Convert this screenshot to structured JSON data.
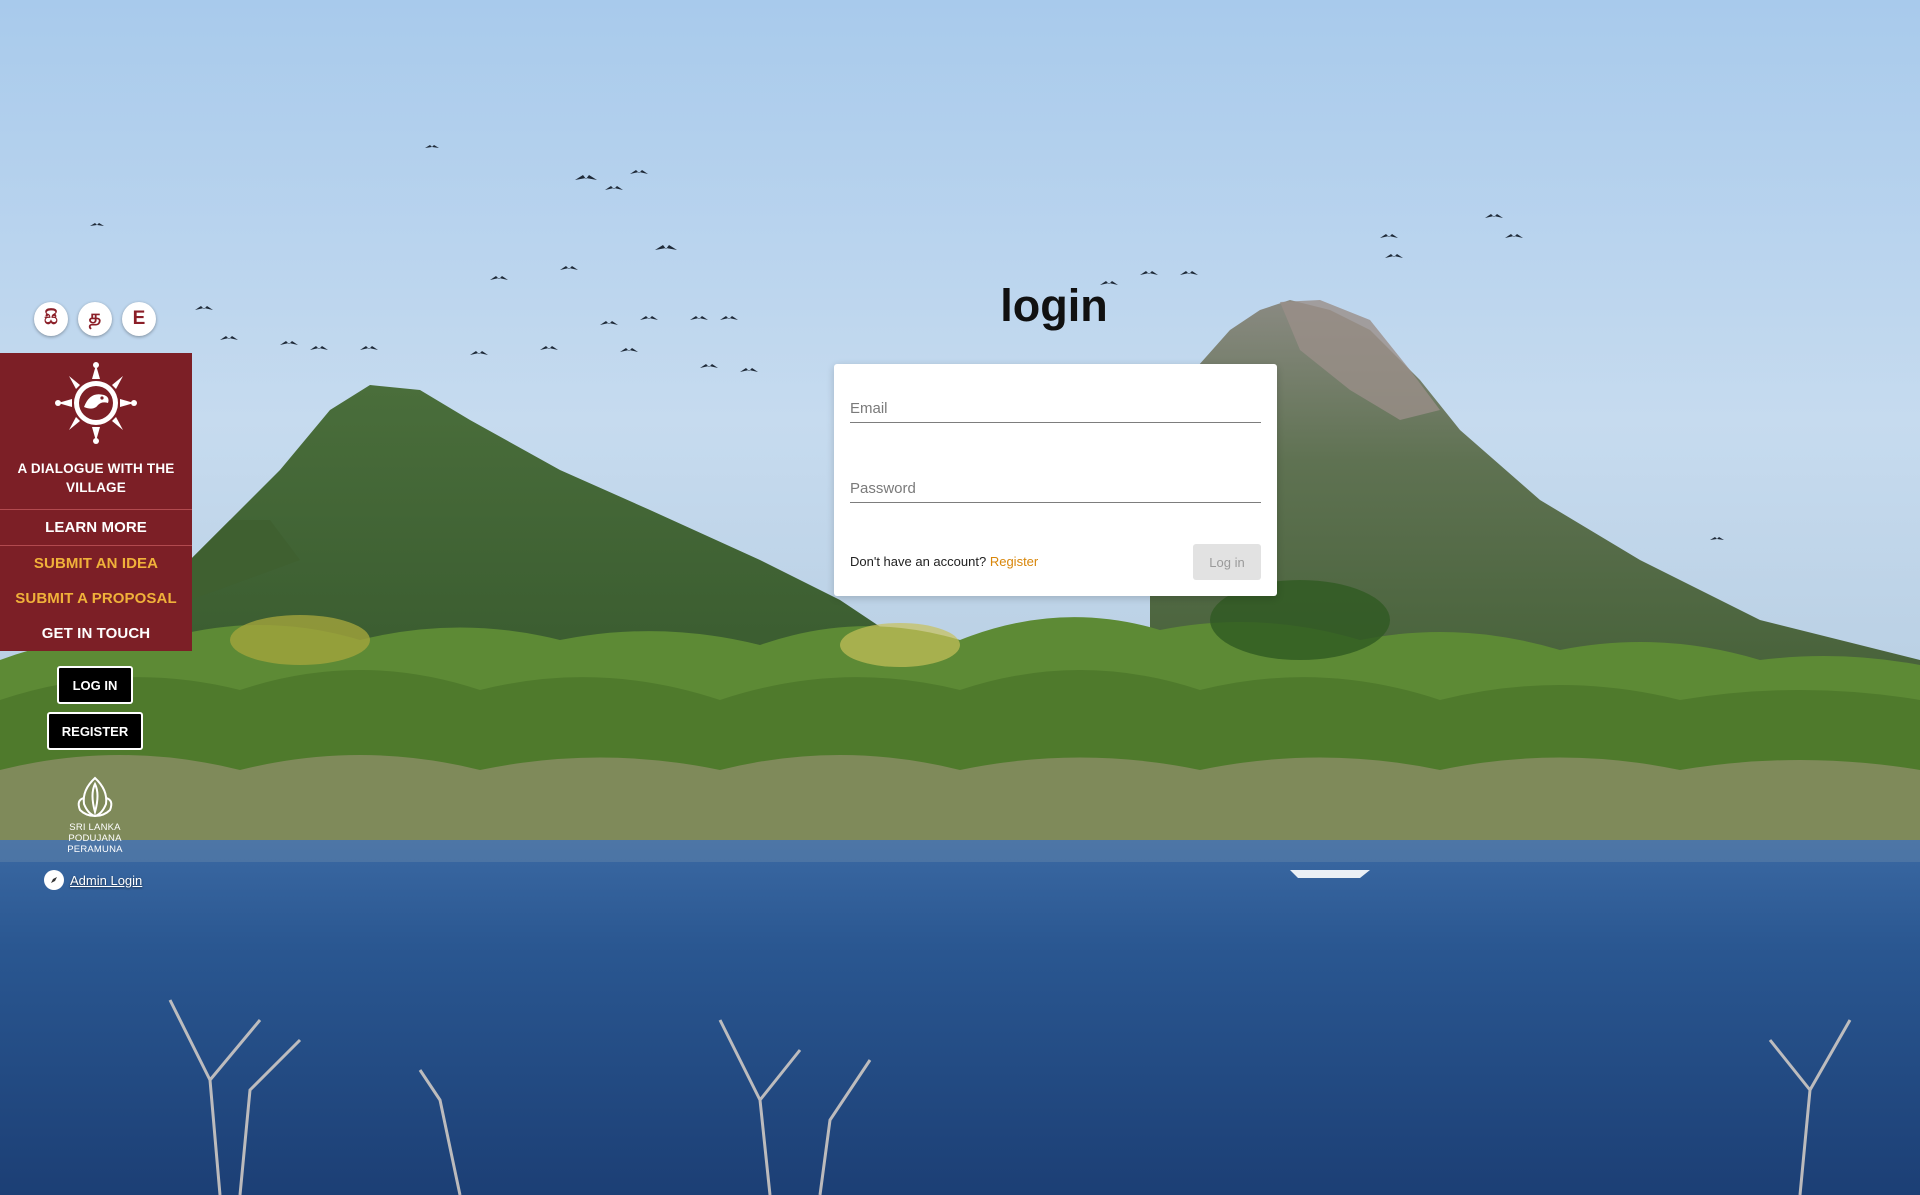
{
  "language_switcher": [
    {
      "label": "සි",
      "name": "lang-sinhala-button"
    },
    {
      "label": "த",
      "name": "lang-tamil-button"
    },
    {
      "label": "E",
      "name": "lang-english-button"
    }
  ],
  "sidebar": {
    "logo_icon": "sun-emblem-icon",
    "tagline": "A DIALOGUE WITH THE VILLAGE",
    "items": [
      {
        "label": "LEARN MORE",
        "style": "white"
      },
      {
        "label": "SUBMIT AN IDEA",
        "style": "gold"
      },
      {
        "label": "SUBMIT A PROPOSAL",
        "style": "gold"
      },
      {
        "label": "GET IN TOUCH",
        "style": "white"
      }
    ]
  },
  "auth": {
    "login_label": "LOG IN",
    "register_label": "REGISTER"
  },
  "brand": {
    "icon": "lotus-bud-icon",
    "line1": "SRI LANKA",
    "line2": "PODUJANA",
    "line3": "PERAMUNA"
  },
  "admin": {
    "icon": "compass-icon",
    "label": "Admin Login"
  },
  "login": {
    "title": "login",
    "email_placeholder": "Email",
    "password_placeholder": "Password",
    "no_account_text": "Don't have an account?",
    "register_link": "Register",
    "submit_label": "Log in"
  },
  "colors": {
    "sidebar_bg": "#7c1f26",
    "accent_gold": "#f0b13a",
    "register_link": "#d8860a"
  }
}
